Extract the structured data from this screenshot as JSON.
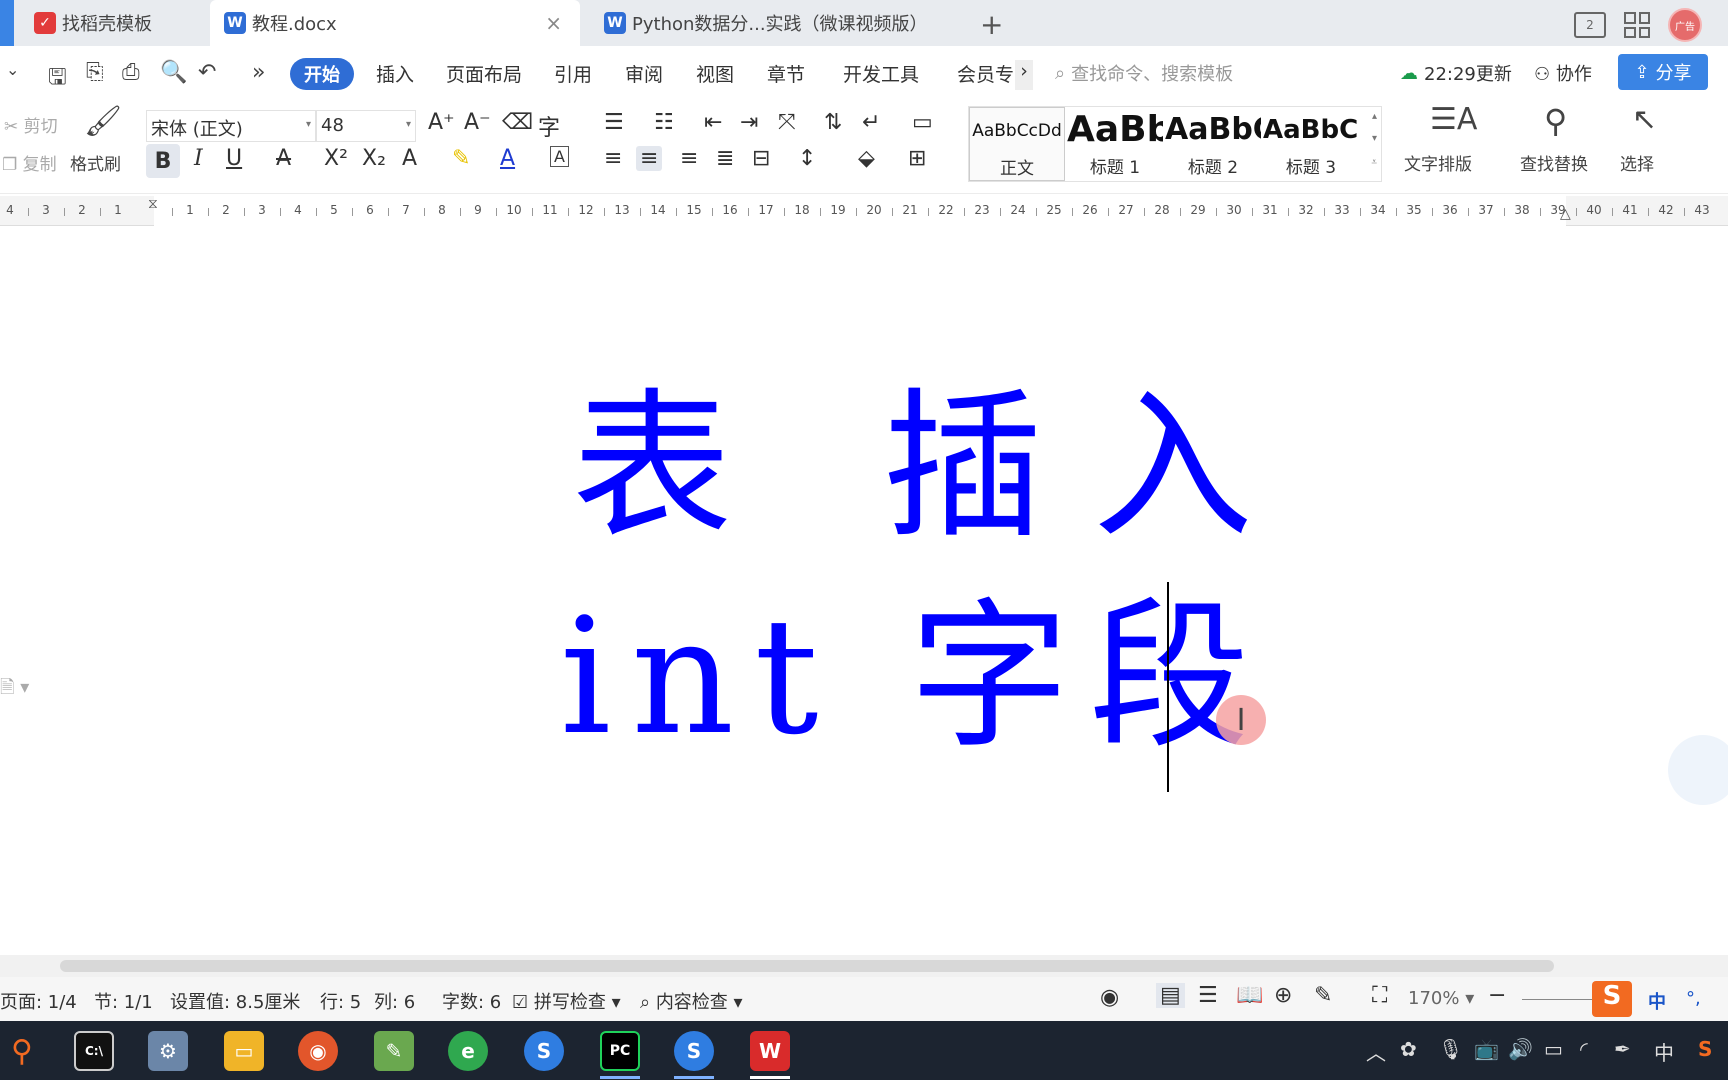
{
  "tabs": [
    {
      "label": "找稻壳模板",
      "icon": "docer-icon",
      "color": "#e23b3b"
    },
    {
      "label": "教程.docx",
      "icon": "wps-writer-icon",
      "color": "#2f6dd5",
      "active": true
    },
    {
      "label": "Python数据分...实践（微课视频版）",
      "icon": "wps-writer-icon",
      "color": "#2f6dd5"
    }
  ],
  "tab_close": "×",
  "new_tab": "+",
  "window": {
    "layout_badge": "2",
    "avatar_text": "广告"
  },
  "menu": {
    "items": [
      "开始",
      "插入",
      "页面布局",
      "引用",
      "审阅",
      "视图",
      "章节",
      "开发工具",
      "会员专"
    ],
    "active": "开始",
    "more": "›",
    "search_placeholder": "查找命令、搜索模板",
    "sync_text": "22:29更新",
    "collab": "协作",
    "share": "分享"
  },
  "ribbon": {
    "cut": "剪切",
    "copy": "复制",
    "format_painter": "格式刷",
    "font_name": "宋体 (正文)",
    "font_size": "48",
    "styles": [
      {
        "preview": "AaBbCcDd",
        "label": "正文"
      },
      {
        "preview": "AaBb",
        "label": "标题 1"
      },
      {
        "preview": "AaBbC",
        "label": "标题 2"
      },
      {
        "preview": "AaBbCc",
        "label": "标题 3"
      }
    ],
    "text_layout": "文字排版",
    "find_replace": "查找替换",
    "select": "选择"
  },
  "ruler": {
    "left": [
      "4",
      "3",
      "2",
      "1"
    ],
    "right": [
      "1",
      "2",
      "3",
      "4",
      "5",
      "6",
      "7",
      "8",
      "9",
      "10",
      "11",
      "12",
      "13",
      "14",
      "15",
      "16",
      "17",
      "18",
      "19",
      "20",
      "21",
      "22",
      "23",
      "24",
      "25",
      "26",
      "27",
      "28",
      "29",
      "30",
      "31",
      "32",
      "33",
      "34",
      "35",
      "36",
      "37",
      "38",
      "39",
      "40",
      "41",
      "42",
      "43"
    ]
  },
  "document": {
    "line1": "表 插入",
    "line2": "int 字段",
    "text_color": "#0000ff"
  },
  "status": {
    "page": "页面: 1/4",
    "section": "节: 1/1",
    "setting": "设置值: 8.5厘米",
    "row": "行: 5",
    "col": "列: 6",
    "words": "字数: 6",
    "spell": "拼写检查",
    "content_check": "内容检查",
    "zoom": "170%",
    "ime": "中"
  },
  "taskbar": {
    "apps": [
      "search",
      "terminal",
      "control-panel",
      "file-explorer",
      "firefox",
      "notepad",
      "edge",
      "sogou",
      "pycharm",
      "sogou-2",
      "wps"
    ],
    "pycharm_label": "PC",
    "tray_lang": "中"
  }
}
